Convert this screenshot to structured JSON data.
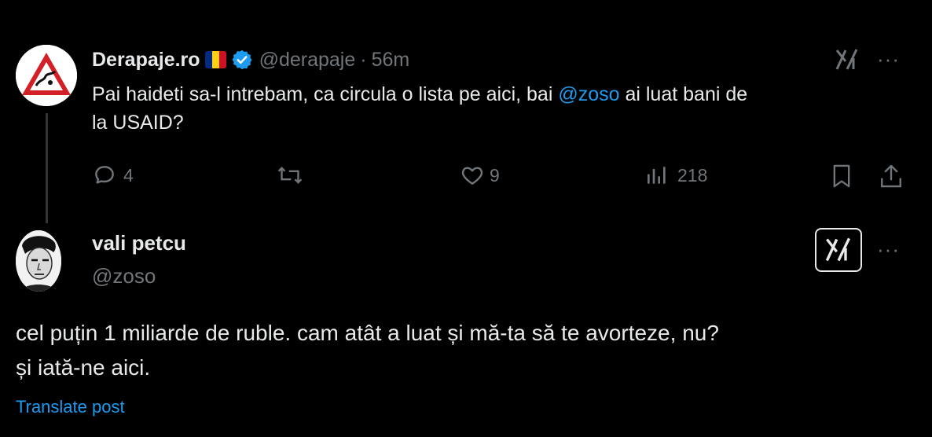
{
  "parent_post": {
    "display_name": "Derapaje.ro",
    "flag_icon": "romania-flag",
    "verified_icon": "verified-badge",
    "handle": "@derapaje",
    "separator": "·",
    "time": "56m",
    "text_before": "Pai haideti sa-l intrebam, ca circula o lista pe aici, bai ",
    "mention": "@zoso",
    "text_after": " ai luat bani de",
    "text_line2": "la USAID?",
    "replies": "4",
    "likes": "9",
    "views": "218"
  },
  "reply_post": {
    "display_name": "vali petcu",
    "handle": "@zoso",
    "line1": "cel puțin 1 miliarde de ruble. cam atât a luat și mă-ta să te avorteze, nu?",
    "line2": "și iată-ne aici.",
    "translate_label": "Translate post"
  },
  "more_label": "···",
  "colors": {
    "background": "#000000",
    "text": "#e7e9ea",
    "muted": "#71767b",
    "accent": "#1d9bf0",
    "verified": "#1d9bf0"
  }
}
